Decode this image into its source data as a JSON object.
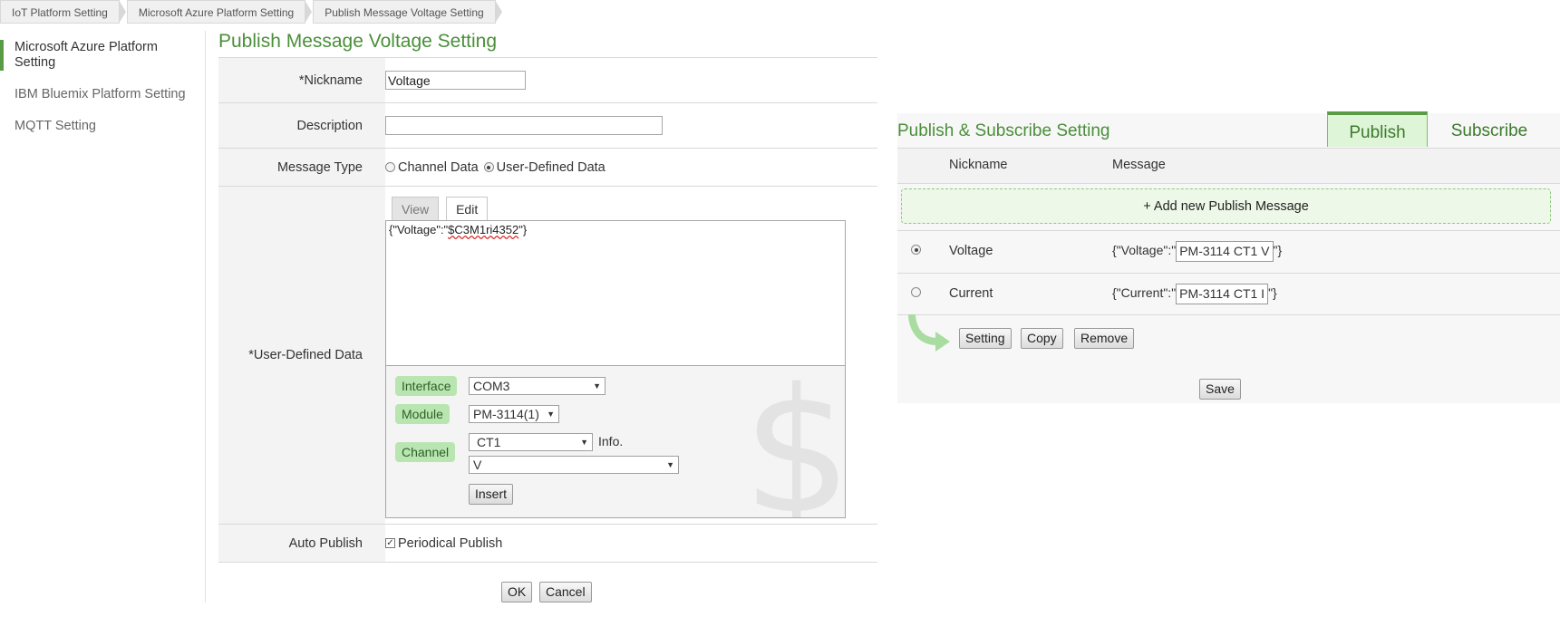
{
  "breadcrumb": [
    "IoT Platform Setting",
    "Microsoft Azure Platform Setting",
    "Publish Message Voltage Setting"
  ],
  "sidebar": {
    "items": [
      {
        "label_line1": "Microsoft Azure Platform",
        "label_line2": "Setting"
      },
      {
        "label_line1": "IBM Bluemix Platform Setting"
      },
      {
        "label_line1": "MQTT Setting"
      }
    ]
  },
  "form": {
    "title": "Publish Message Voltage Setting",
    "nickname_label": "*Nickname",
    "nickname_value": "Voltage",
    "description_label": "Description",
    "description_value": "",
    "message_type_label": "Message Type",
    "message_type_options": [
      "Channel Data",
      "User-Defined Data"
    ],
    "message_type_selected": "User-Defined Data",
    "user_defined_label": "*User-Defined Data",
    "tabs": [
      "View",
      "Edit"
    ],
    "active_tab": "Edit",
    "editor_prefix": "{\"Voltage\":\"",
    "editor_var": "$C3M1ri4352",
    "editor_suffix": "\"}",
    "interface_label": "Interface",
    "interface_value": "COM3",
    "module_label": "Module",
    "module_value": "PM-3114(1)",
    "channel_label": "Channel",
    "channel_value": "CT1",
    "info_label": "Info.",
    "info_value": "V",
    "insert_label": "Insert",
    "auto_publish_label": "Auto Publish",
    "periodical_label": "Periodical Publish",
    "periodical_checked": true,
    "ok_label": "OK",
    "cancel_label": "Cancel"
  },
  "right": {
    "title": "Publish & Subscribe Setting",
    "tab_publish": "Publish",
    "tab_subscribe": "Subscribe",
    "col_nickname": "Nickname",
    "col_message": "Message",
    "add_label": "+ Add new Publish Message",
    "rows": [
      {
        "nickname": "Voltage",
        "prefix": "{\"Voltage\":\"",
        "value": "PM-3114 CT1 V",
        "suffix": "\"}",
        "selected": true
      },
      {
        "nickname": "Current",
        "prefix": "{\"Current\":\"",
        "value": "PM-3114 CT1 I",
        "suffix": "\"}",
        "selected": false
      }
    ],
    "setting_label": "Setting",
    "copy_label": "Copy",
    "remove_label": "Remove",
    "save_label": "Save"
  }
}
